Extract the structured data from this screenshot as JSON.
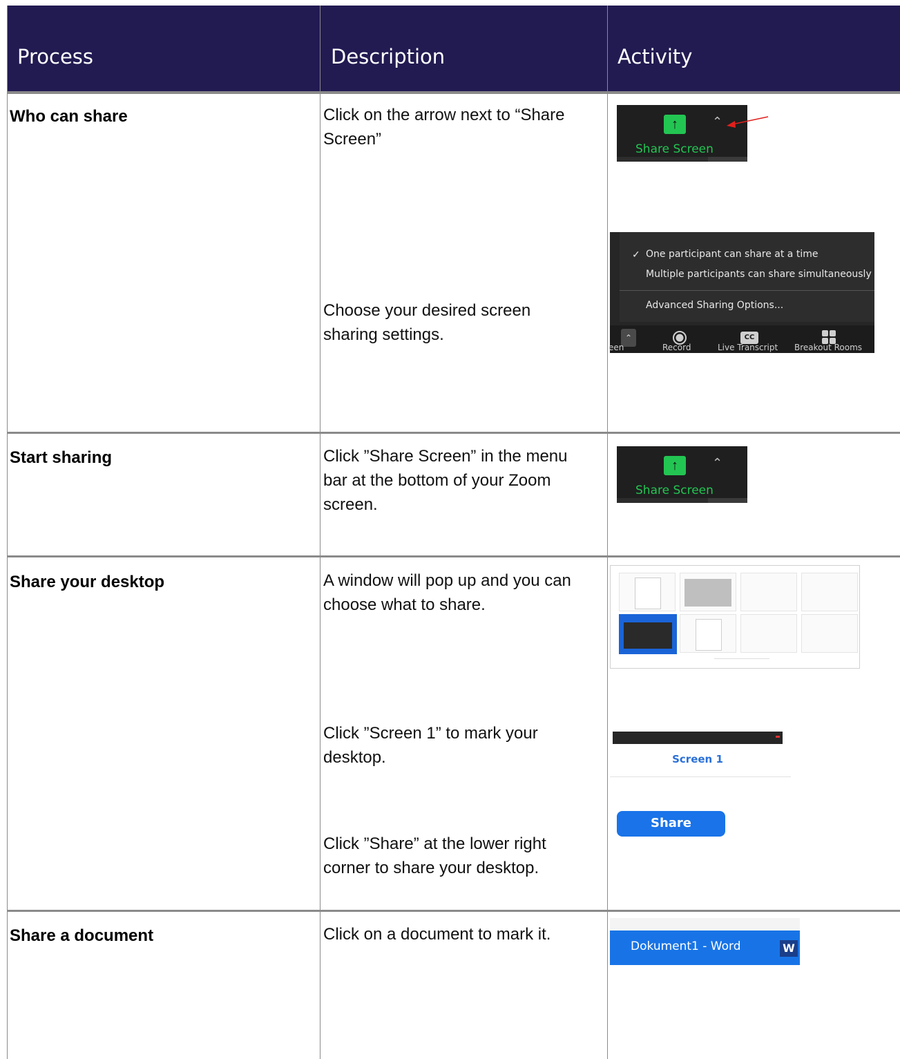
{
  "header": {
    "col_process": "Process",
    "col_description": "Description",
    "col_activity": "Activity"
  },
  "rows": [
    {
      "process": "Who can share",
      "description_1": "Click on the arrow next to “Share Screen”",
      "description_2": "Choose your desired screen sharing settings."
    },
    {
      "process": "Start sharing",
      "description_1": "Click ”Share Screen” in the menu bar at the bottom of your Zoom screen."
    },
    {
      "process": "Share your desktop",
      "description_1": "A window will pop up and you can choose what to share.",
      "description_2": "Click ”Screen 1” to mark your desktop.",
      "description_3": "Click ”Share” at the lower right corner to share your desktop."
    },
    {
      "process": "Share a document",
      "description_1": "Click on a document to mark it."
    }
  ],
  "screens": {
    "share_screen_label": "Share Screen",
    "menu": {
      "option_one": "One participant can share at a time",
      "option_multiple": "Multiple participants can share simultaneously",
      "advanced": "Advanced Sharing Options...",
      "toolbar": [
        "een",
        "Record",
        "Live Transcript",
        "Breakout Rooms"
      ]
    },
    "screen1_label": "Screen 1",
    "share_button": "Share",
    "document_label": "Dokument1 - Word",
    "word_icon": "W"
  },
  "icons": {
    "share_up": "up-arrow-icon",
    "chevron": "chevron-up-icon",
    "record": "record-icon",
    "cc": "cc-icon",
    "breakout": "grid-icon",
    "word": "word-icon"
  },
  "colors": {
    "header_bg": "#221b52",
    "zoom_green": "#23c552",
    "zoom_blue": "#1a73e8",
    "pointer_red": "#e0201c"
  }
}
